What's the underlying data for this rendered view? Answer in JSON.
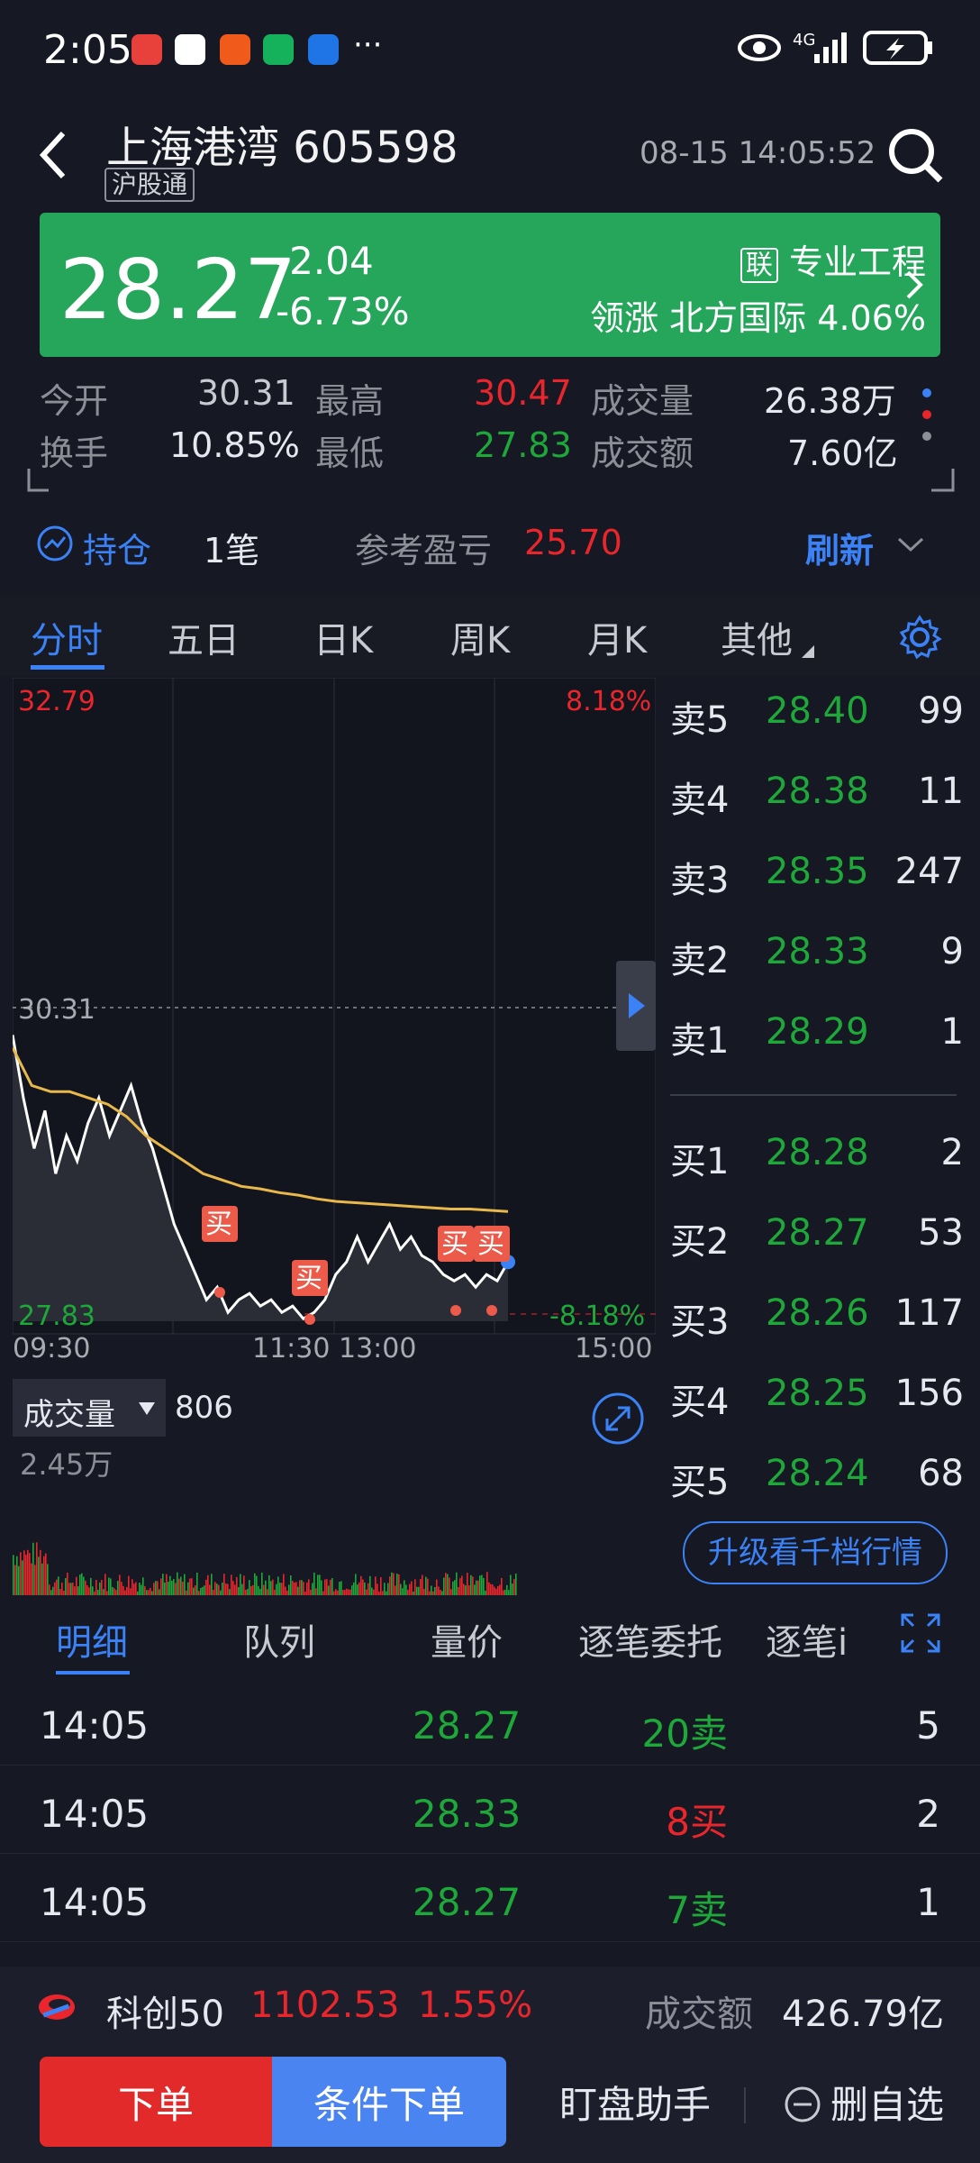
{
  "status_bar": {
    "time": "2:05",
    "dots": "···",
    "signal": "4G"
  },
  "header": {
    "title": "上海港湾 605598",
    "badge": "沪股通",
    "datetime": "08-15 14:05:52"
  },
  "quote": {
    "price": "28.27",
    "change": "-2.04",
    "change_pct": "-6.73%",
    "industry_badge": "联",
    "industry": "专业工程",
    "leader_label": "领涨",
    "leader_name": "北方国际",
    "leader_pct": "4.06%"
  },
  "stats": {
    "open_label": "今开",
    "open": "30.31",
    "high_label": "最高",
    "high": "30.47",
    "volume_label": "成交量",
    "volume": "26.38万",
    "turnover_label": "换手",
    "turnover": "10.85%",
    "low_label": "最低",
    "low": "27.83",
    "amount_label": "成交额",
    "amount": "7.60亿"
  },
  "position": {
    "label": "持仓",
    "count": "1笔",
    "pnl_label": "参考盈亏",
    "pnl": "25.70",
    "refresh": "刷新"
  },
  "tabs": [
    "分时",
    "五日",
    "日K",
    "周K",
    "月K",
    "其他"
  ],
  "chart": {
    "top_left": "32.79",
    "top_right": "8.18%",
    "ref": "30.31",
    "bottom_left": "27.83",
    "bottom_right": "-8.18%",
    "x_labels": [
      "09:30",
      "11:30 13:00",
      "15:00"
    ],
    "buy_marker": "买"
  },
  "chart_data": {
    "type": "line",
    "title": "",
    "ylim": [
      27.83,
      32.79
    ],
    "reference": 30.31,
    "series": [
      {
        "values": [
          30.1,
          29.6,
          29.2,
          29.5,
          29.0,
          29.3,
          29.1,
          29.4,
          29.6,
          29.3,
          29.5,
          29.7,
          29.4,
          29.2,
          28.9,
          28.6,
          28.4,
          28.2,
          28.0,
          28.1,
          27.9,
          28.0,
          28.05,
          27.95,
          28.0,
          27.9,
          27.95,
          27.85,
          27.9,
          28.0,
          28.2,
          28.3,
          28.5,
          28.3,
          28.45,
          28.6,
          28.4,
          28.5,
          28.35,
          28.3,
          28.2,
          28.15,
          28.2,
          28.1,
          28.2,
          28.15,
          28.3
        ]
      },
      {
        "values": [
          30.0,
          29.7,
          29.65,
          29.65,
          29.6,
          29.55,
          29.45,
          29.3,
          29.2,
          29.1,
          29.0,
          28.95,
          28.9,
          28.88,
          28.85,
          28.83,
          28.8,
          28.78,
          28.77,
          28.76,
          28.75,
          28.74,
          28.73,
          28.72,
          28.72,
          28.71,
          28.7
        ]
      }
    ]
  },
  "orderbook": {
    "asks": [
      {
        "label": "卖5",
        "price": "28.40",
        "qty": "99"
      },
      {
        "label": "卖4",
        "price": "28.38",
        "qty": "11"
      },
      {
        "label": "卖3",
        "price": "28.35",
        "qty": "247"
      },
      {
        "label": "卖2",
        "price": "28.33",
        "qty": "9"
      },
      {
        "label": "卖1",
        "price": "28.29",
        "qty": "1"
      }
    ],
    "bids": [
      {
        "label": "买1",
        "price": "28.28",
        "qty": "2"
      },
      {
        "label": "买2",
        "price": "28.27",
        "qty": "53"
      },
      {
        "label": "买3",
        "price": "28.26",
        "qty": "117"
      },
      {
        "label": "买4",
        "price": "28.25",
        "qty": "156"
      },
      {
        "label": "买5",
        "price": "28.24",
        "qty": "68"
      }
    ],
    "upgrade": "升级看千档行情"
  },
  "volume": {
    "label": "成交量",
    "value": "806",
    "max": "2.45万"
  },
  "detail_tabs": [
    "明细",
    "队列",
    "量价",
    "逐笔委托",
    "逐笔i"
  ],
  "trades": [
    {
      "time": "14:05",
      "price": "28.27",
      "vol": "20卖",
      "count": "5"
    },
    {
      "time": "14:05",
      "price": "28.33",
      "vol": "8买",
      "count": "2"
    },
    {
      "time": "14:05",
      "price": "28.27",
      "vol": "7卖",
      "count": "1"
    }
  ],
  "index_bar": {
    "name": "科创50",
    "value": "1102.53",
    "pct": "1.55%",
    "amount_label": "成交额",
    "amount": "426.79亿"
  },
  "bottom": {
    "order": "下单",
    "cond_order": "条件下单",
    "assistant": "盯盘助手",
    "remove": "删自选"
  }
}
